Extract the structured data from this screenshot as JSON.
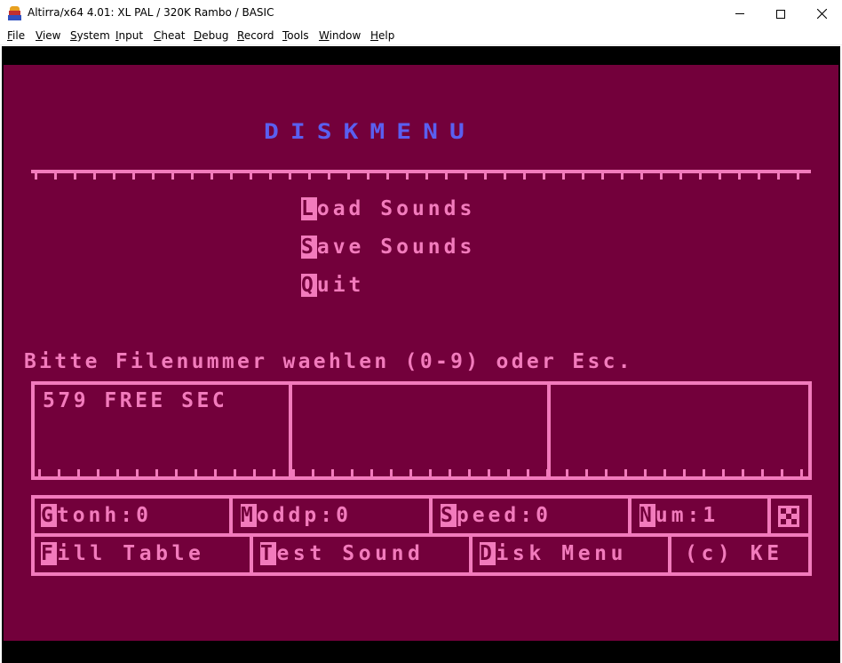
{
  "window": {
    "title": "Altirra/x64 4.01: XL PAL / 320K Rambo / BASIC"
  },
  "menubar": {
    "items": [
      {
        "label": "File",
        "accel": "F",
        "rest": "ile"
      },
      {
        "label": "View",
        "accel": "V",
        "rest": "iew"
      },
      {
        "label": "System",
        "accel": "S",
        "rest": "ystem"
      },
      {
        "label": "Input",
        "accel": "I",
        "rest": "nput"
      },
      {
        "label": "Cheat",
        "accel": "C",
        "rest": "heat"
      },
      {
        "label": "Debug",
        "accel": "D",
        "rest": "ebug"
      },
      {
        "label": "Record",
        "accel": "R",
        "rest": "ecord"
      },
      {
        "label": "Tools",
        "accel": "T",
        "rest": "ools"
      },
      {
        "label": "Window",
        "accel": "W",
        "rest": "indow"
      },
      {
        "label": "Help",
        "accel": "H",
        "rest": "elp"
      }
    ]
  },
  "screen": {
    "title": "DISKMENU",
    "menu": [
      {
        "key": "L",
        "rest": "oad Sounds"
      },
      {
        "key": "S",
        "rest": "ave Sounds"
      },
      {
        "key": "Q",
        "rest": "uit"
      }
    ],
    "prompt": "Bitte Filenummer waehlen (0-9) oder Esc.",
    "file_panel": {
      "free": "579 FREE SEC"
    },
    "status_row1": [
      {
        "key": "G",
        "rest": "tonh:0"
      },
      {
        "key": "M",
        "rest": "oddp:0"
      },
      {
        "key": "S",
        "rest": "peed:0"
      },
      {
        "key": "N",
        "rest": "um:1"
      }
    ],
    "status_row2": [
      {
        "key": "F",
        "rest": "ill Table"
      },
      {
        "key": "T",
        "rest": "est Sound"
      },
      {
        "key": "D",
        "rest": "isk Menu"
      },
      {
        "key": "",
        "rest": "(c) KE"
      }
    ]
  },
  "colors": {
    "background": "#73003b",
    "foreground": "#f27bbc",
    "title": "#5a5ff0"
  }
}
